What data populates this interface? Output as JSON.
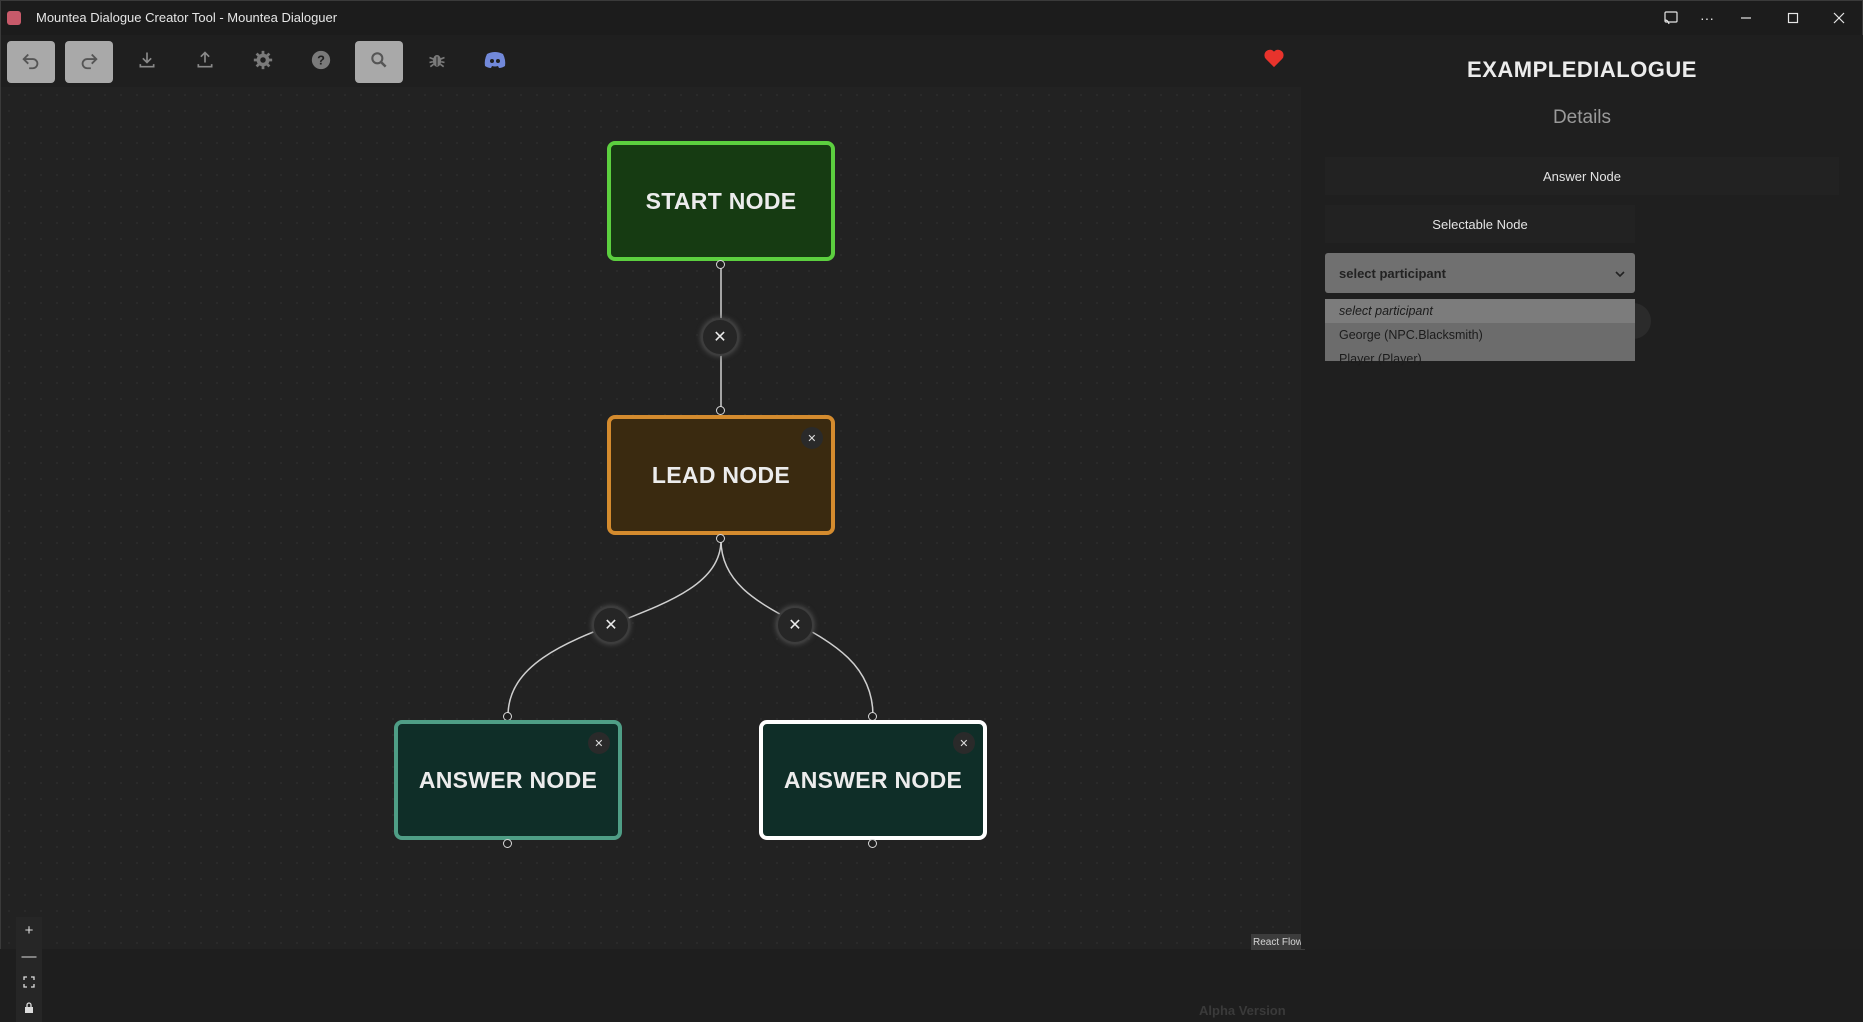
{
  "window": {
    "title": "Mountea Dialogue Creator Tool - Mountea Dialoguer"
  },
  "titlebar_controls": [
    {
      "icon": "cast-icon",
      "glyph": "⧉"
    },
    {
      "icon": "more-icon",
      "glyph": "···"
    },
    {
      "icon": "minimize-icon",
      "glyph": "—"
    },
    {
      "icon": "maximize-icon",
      "glyph": "☐"
    },
    {
      "icon": "close-icon",
      "glyph": "✕"
    }
  ],
  "toolbar": {
    "buttons": [
      {
        "icon": "undo-icon",
        "active": true
      },
      {
        "icon": "redo-icon",
        "active": true
      },
      {
        "icon": "download-icon",
        "active": false
      },
      {
        "icon": "upload-icon",
        "active": false
      },
      {
        "icon": "gear-icon",
        "active": false
      },
      {
        "icon": "help-icon",
        "active": false
      },
      {
        "icon": "search-icon",
        "active": true
      },
      {
        "icon": "bug-icon",
        "active": false
      },
      {
        "icon": "discord-icon",
        "active": false
      }
    ],
    "favorite_icon": "heart-icon"
  },
  "graph": {
    "nodes": {
      "start": {
        "label": "START NODE",
        "color": "#5ccf3f"
      },
      "lead": {
        "label": "LEAD NODE",
        "color": "#d48b2e"
      },
      "answer_left": {
        "label": "ANSWER NODE",
        "color": "#4f9e86"
      },
      "answer_right": {
        "label": "ANSWER NODE",
        "color": "#ffffff"
      }
    },
    "delete_glyph": "✕"
  },
  "panel": {
    "title": "EXAMPLEDIALOGUE",
    "subtitle": "Details",
    "node_type": "Answer Node",
    "selectable_label": "Selectable Node",
    "participant_select": {
      "value": "select participant",
      "options": [
        "select participant",
        "George (NPC.Blacksmith)",
        "Player (Player)"
      ]
    }
  },
  "zoom_controls": [
    "+",
    "—",
    "⛶",
    "🔒"
  ],
  "footer": {
    "alpha_label": "Alpha Version",
    "reactflow_label": "React Flow"
  }
}
